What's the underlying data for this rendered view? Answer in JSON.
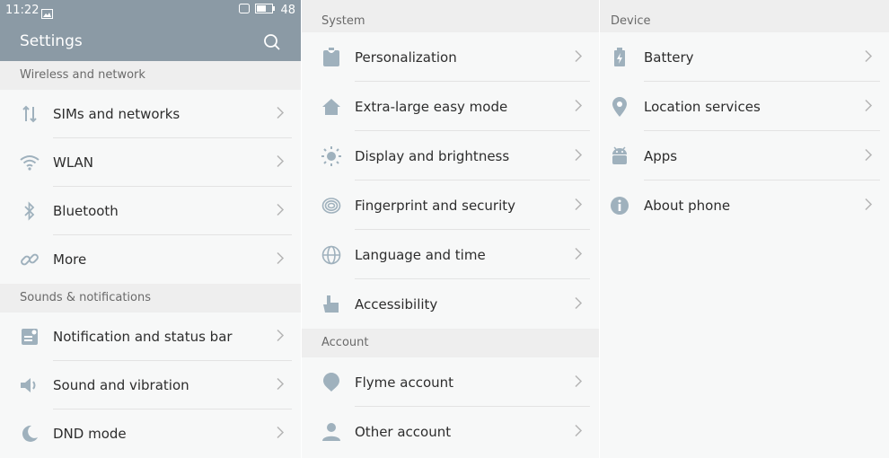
{
  "status_bar": {
    "time": "11:22",
    "battery": "48"
  },
  "header": {
    "title": "Settings"
  },
  "panel1": {
    "sections": [
      {
        "title": "Wireless and network",
        "items": [
          {
            "label": "SIMs and networks",
            "icon": "sim-networks-icon"
          },
          {
            "label": "WLAN",
            "icon": "wifi-icon"
          },
          {
            "label": "Bluetooth",
            "icon": "bluetooth-icon"
          },
          {
            "label": "More",
            "icon": "link-icon"
          }
        ]
      },
      {
        "title": "Sounds & notifications",
        "items": [
          {
            "label": "Notification and status bar",
            "icon": "notification-icon"
          },
          {
            "label": "Sound and vibration",
            "icon": "speaker-icon"
          },
          {
            "label": "DND mode",
            "icon": "moon-icon"
          }
        ]
      }
    ]
  },
  "panel2": {
    "sections": [
      {
        "title": "System",
        "items": [
          {
            "label": "Personalization",
            "icon": "shirt-icon"
          },
          {
            "label": "Extra-large easy mode",
            "icon": "home-icon"
          },
          {
            "label": "Display and brightness",
            "icon": "sun-icon"
          },
          {
            "label": "Fingerprint and security",
            "icon": "fingerprint-icon"
          },
          {
            "label": "Language and time",
            "icon": "globe-icon"
          },
          {
            "label": "Accessibility",
            "icon": "hand-icon"
          }
        ]
      },
      {
        "title": "Account",
        "items": [
          {
            "label": "Flyme account",
            "icon": "balloon-icon"
          },
          {
            "label": "Other account",
            "icon": "person-icon"
          }
        ]
      }
    ]
  },
  "panel3": {
    "sections": [
      {
        "title": "Device",
        "items": [
          {
            "label": "Battery",
            "icon": "battery-icon"
          },
          {
            "label": "Location services",
            "icon": "location-pin-icon"
          },
          {
            "label": "Apps",
            "icon": "android-icon"
          },
          {
            "label": "About phone",
            "icon": "info-icon"
          }
        ]
      }
    ]
  },
  "colors": {
    "header_bg": "#8b9aa5",
    "icon": "#9fb1bd",
    "section_bg": "#eeeeee",
    "row_bg": "#f7f8f8",
    "text": "#2d2d2d",
    "chevron": "#b5b5b5"
  }
}
